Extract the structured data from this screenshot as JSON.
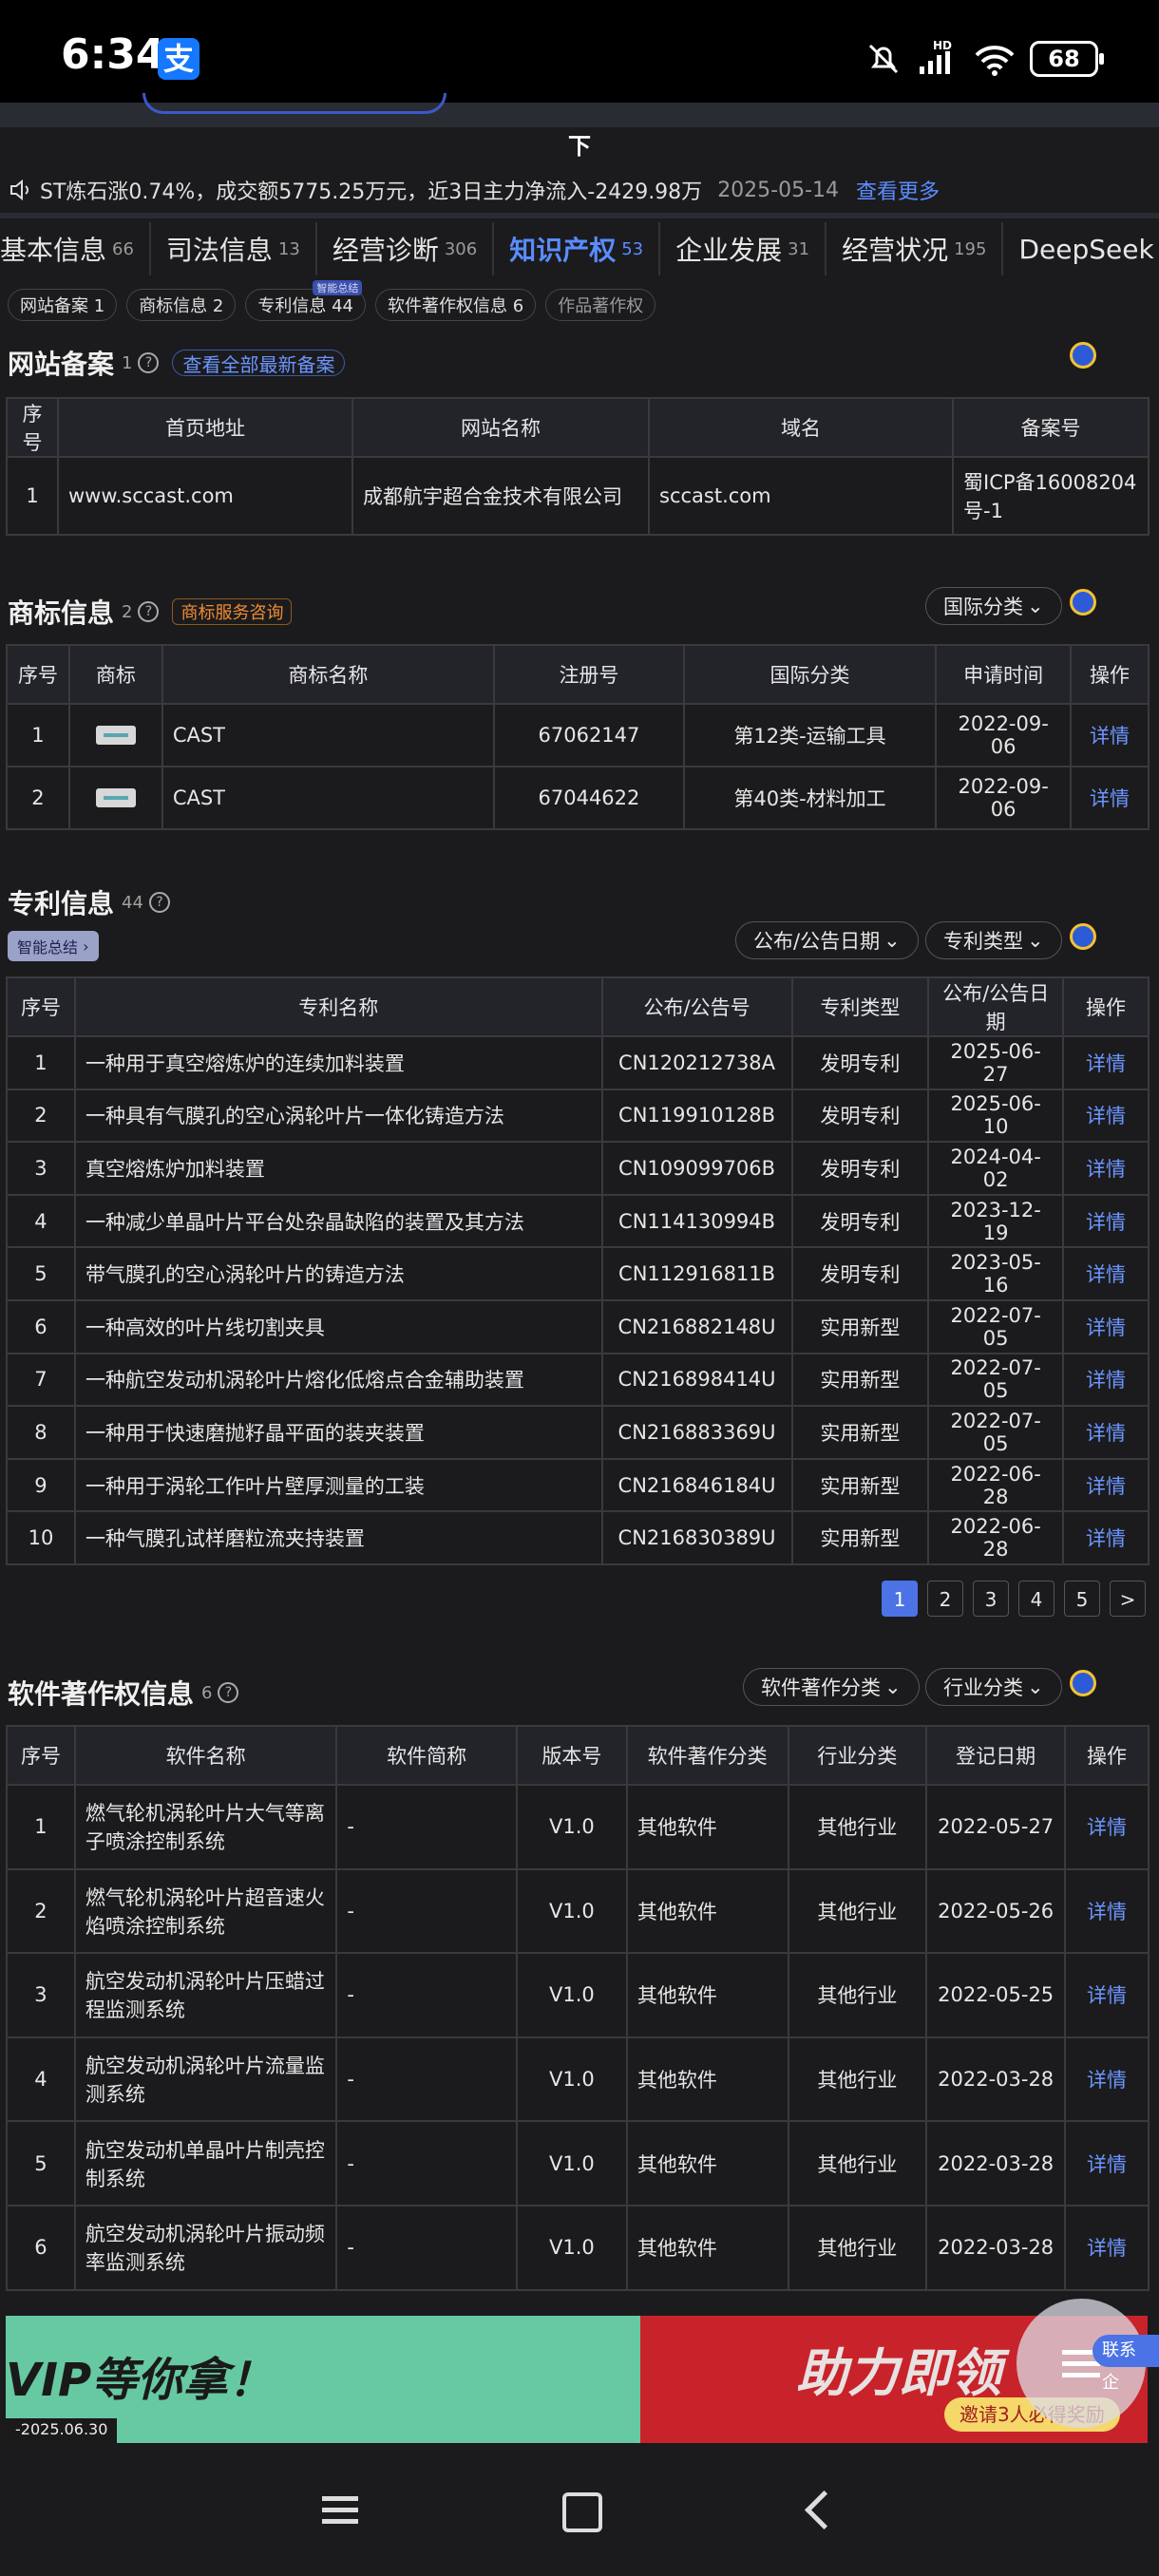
{
  "status_bar": {
    "time": "6:34",
    "alipay_icon": "支",
    "signal_label": "HD",
    "battery": "68"
  },
  "down_label": "下",
  "ticker": {
    "text": "ST炼石涨0.74%，成交额5775.25万元，近3日主力净流入-2429.98万",
    "date": "2025-05-14",
    "more": "查看更多"
  },
  "tabs": [
    {
      "label": "基本信息",
      "count": "66"
    },
    {
      "label": "司法信息",
      "count": "13"
    },
    {
      "label": "经营诊断",
      "count": "306"
    },
    {
      "label": "知识产权",
      "count": "53",
      "active": true
    },
    {
      "label": "企业发展",
      "count": "31"
    },
    {
      "label": "经营状况",
      "count": "195"
    },
    {
      "label": "DeepSeek",
      "count": ""
    }
  ],
  "subtabs": [
    {
      "label": "网站备案 1"
    },
    {
      "label": "商标信息 2"
    },
    {
      "label": "专利信息 44",
      "sup": "智能总结"
    },
    {
      "label": "软件著作权信息 6"
    },
    {
      "label": "作品著作权"
    }
  ],
  "website": {
    "title": "网站备案",
    "count": "1",
    "link": "查看全部最新备案",
    "headers": [
      "序号",
      "首页地址",
      "网站名称",
      "域名",
      "备案号"
    ],
    "rows": [
      [
        "1",
        "www.sccast.com",
        "成都航宇超合金技术有限公司",
        "sccast.com",
        "蜀ICP备16008204号-1"
      ]
    ]
  },
  "trademark": {
    "title": "商标信息",
    "count": "2",
    "consult": "商标服务咨询",
    "filter": "国际分类",
    "headers": [
      "序号",
      "商标",
      "商标名称",
      "注册号",
      "国际分类",
      "申请时间",
      "操作"
    ],
    "rows": [
      [
        "1",
        "",
        "CAST",
        "67062147",
        "第12类-运输工具",
        "2022-09-06",
        "详情"
      ],
      [
        "2",
        "",
        "CAST",
        "67044622",
        "第40类-材料加工",
        "2022-09-06",
        "详情"
      ]
    ]
  },
  "patent": {
    "title": "专利信息",
    "count": "44",
    "smart": "智能总结",
    "filters": [
      "公布/公告日期",
      "专利类型"
    ],
    "headers": [
      "序号",
      "专利名称",
      "公布/公告号",
      "专利类型",
      "公布/公告日期",
      "操作"
    ],
    "rows": [
      [
        "1",
        "一种用于真空熔炼炉的连续加料装置",
        "CN120212738A",
        "发明专利",
        "2025-06-27",
        "详情"
      ],
      [
        "2",
        "一种具有气膜孔的空心涡轮叶片一体化铸造方法",
        "CN119910128B",
        "发明专利",
        "2025-06-10",
        "详情"
      ],
      [
        "3",
        "真空熔炼炉加料装置",
        "CN109099706B",
        "发明专利",
        "2024-04-02",
        "详情"
      ],
      [
        "4",
        "一种减少单晶叶片平台处杂晶缺陷的装置及其方法",
        "CN114130994B",
        "发明专利",
        "2023-12-19",
        "详情"
      ],
      [
        "5",
        "带气膜孔的空心涡轮叶片的铸造方法",
        "CN112916811B",
        "发明专利",
        "2023-05-16",
        "详情"
      ],
      [
        "6",
        "一种高效的叶片线切割夹具",
        "CN216882148U",
        "实用新型",
        "2022-07-05",
        "详情"
      ],
      [
        "7",
        "一种航空发动机涡轮叶片熔化低熔点合金辅助装置",
        "CN216898414U",
        "实用新型",
        "2022-07-05",
        "详情"
      ],
      [
        "8",
        "一种用于快速磨抛籽晶平面的装夹装置",
        "CN216883369U",
        "实用新型",
        "2022-07-05",
        "详情"
      ],
      [
        "9",
        "一种用于涡轮工作叶片壁厚测量的工装",
        "CN216846184U",
        "实用新型",
        "2022-06-28",
        "详情"
      ],
      [
        "10",
        "一种气膜孔试样磨粒流夹持装置",
        "CN216830389U",
        "实用新型",
        "2022-06-28",
        "详情"
      ]
    ],
    "pages": [
      "1",
      "2",
      "3",
      "4",
      "5",
      ">"
    ]
  },
  "software": {
    "title": "软件著作权信息",
    "count": "6",
    "filters": [
      "软件著作分类",
      "行业分类"
    ],
    "headers": [
      "序号",
      "软件名称",
      "软件简称",
      "版本号",
      "软件著作分类",
      "行业分类",
      "登记日期",
      "操作"
    ],
    "rows": [
      [
        "1",
        "燃气轮机涡轮叶片大气等离子喷涂控制系统",
        "-",
        "V1.0",
        "其他软件",
        "其他行业",
        "2022-05-27",
        "详情"
      ],
      [
        "2",
        "燃气轮机涡轮叶片超音速火焰喷涂控制系统",
        "-",
        "V1.0",
        "其他软件",
        "其他行业",
        "2022-05-26",
        "详情"
      ],
      [
        "3",
        "航空发动机涡轮叶片压蜡过程监测系统",
        "-",
        "V1.0",
        "其他软件",
        "其他行业",
        "2022-05-25",
        "详情"
      ],
      [
        "4",
        "航空发动机涡轮叶片流量监测系统",
        "-",
        "V1.0",
        "其他软件",
        "其他行业",
        "2022-03-28",
        "详情"
      ],
      [
        "5",
        "航空发动机单晶叶片制壳控制系统",
        "-",
        "V1.0",
        "其他软件",
        "其他行业",
        "2022-03-28",
        "详情"
      ],
      [
        "6",
        "航空发动机涡轮叶片振动频率监测系统",
        "-",
        "V1.0",
        "其他软件",
        "其他行业",
        "2022-03-28",
        "详情"
      ]
    ]
  },
  "banner": {
    "left_text": "VIP等你拿！",
    "left_date": "-2025.06.30",
    "right_text": "助力即领",
    "right_sub": "邀请3人必得奖励",
    "contact": "联系企"
  },
  "colors": {
    "accent": "#5a8cff",
    "background": "#1b1b1d",
    "header_bg": "#23242a"
  }
}
